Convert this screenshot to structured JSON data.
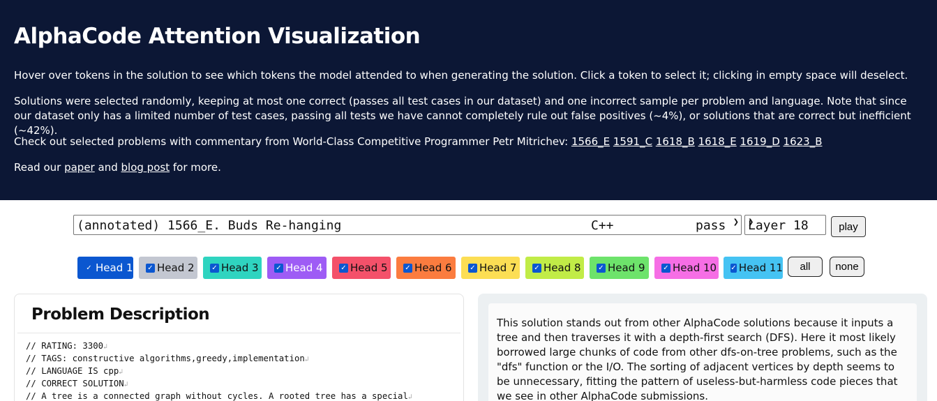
{
  "header": {
    "title": "AlphaCode Attention Visualization",
    "intro": "Hover over tokens in the solution to see which tokens the model attended to when generating the solution. Click a token to select it; clicking in empty space will deselect.",
    "selection_note": "Solutions were selected randomly, keeping at most one correct (passes all test cases in our dataset) and one incorrect sample per problem and language. Note that since our dataset only has a limited number of test cases, passing all tests we have cannot completely rule out false positives (~4%), or solutions that are correct but inefficient (~42%).",
    "commentary_prefix": "Check out selected problems with commentary from World-Class Competitive Programmer Petr Mitrichev:",
    "commentary_links": [
      "1566_E",
      "1591_C",
      "1618_B",
      "1618_E",
      "1619_D",
      "1623_B"
    ],
    "read_prefix": "Read our",
    "paper_link": "paper",
    "read_and": "and",
    "blog_link": "blog post",
    "read_suffix": "for more."
  },
  "controls": {
    "problem_name": "(annotated) 1566_E. Buds Re-hanging",
    "problem_language": "C++",
    "problem_status": "pass",
    "layer": "Layer 18",
    "play_label": "play",
    "all_label": "all",
    "none_label": "none"
  },
  "heads": [
    {
      "label": "Head 1",
      "color": "#0b57d0",
      "text_color": "#ffffff"
    },
    {
      "label": "Head 2",
      "color": "#c3c7d1",
      "text_color": "#111111"
    },
    {
      "label": "Head 3",
      "color": "#2fd4c0",
      "text_color": "#111111"
    },
    {
      "label": "Head 4",
      "color": "#9e5cf5",
      "text_color": "#ffffff"
    },
    {
      "label": "Head 5",
      "color": "#f4516a",
      "text_color": "#111111"
    },
    {
      "label": "Head 6",
      "color": "#fb7c3f",
      "text_color": "#111111"
    },
    {
      "label": "Head 7",
      "color": "#fcde54",
      "text_color": "#111111"
    },
    {
      "label": "Head 8",
      "color": "#c1ec47",
      "text_color": "#111111"
    },
    {
      "label": "Head 9",
      "color": "#6de36b",
      "text_color": "#111111"
    },
    {
      "label": "Head 10",
      "color": "#f66ee5",
      "text_color": "#111111"
    },
    {
      "label": "Head 11",
      "color": "#45c3f3",
      "text_color": "#111111"
    }
  ],
  "problem": {
    "heading": "Problem Description",
    "lines": [
      "// RATING: 3300",
      "// TAGS: constructive algorithms,greedy,implementation",
      "// LANGUAGE IS cpp",
      "// CORRECT SOLUTION",
      "// A tree is a connected graph without cycles. A rooted tree has a special"
    ],
    "newline_glyph": "↲"
  },
  "commentary": {
    "text": "This solution stands out from other AlphaCode solutions because it inputs a tree and then traverses it with a depth-first search (DFS). Here it most likely borrowed large chunks of code from other dfs-on-tree problems, such as the \"dfs\" function or the I/O. The sorting of adjacent vertices by depth seems to be unnecessary, fitting the pattern of useless-but-harmless code pieces that we see in other AlphaCode submissions."
  }
}
